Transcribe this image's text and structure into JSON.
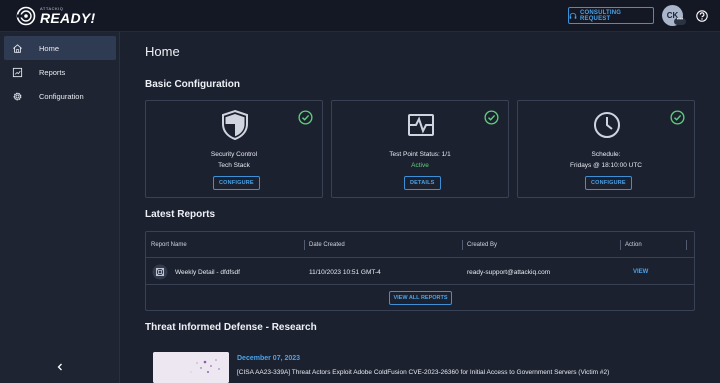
{
  "header": {
    "logo_small": "ATTACKIQ",
    "logo_big": "READY!",
    "consulting_label": "CONSULTING REQUEST",
    "avatar_initials": "CK",
    "avatar_more": "•••"
  },
  "sidebar": {
    "items": [
      {
        "label": "Home",
        "icon": "home-icon",
        "active": true
      },
      {
        "label": "Reports",
        "icon": "reports-icon",
        "active": false
      },
      {
        "label": "Configuration",
        "icon": "gear-icon",
        "active": false
      }
    ],
    "collapse_icon": "chevron-left-icon"
  },
  "main": {
    "page_title": "Home",
    "basic_config": {
      "title": "Basic Configuration",
      "cards": [
        {
          "line1": "Security Control",
          "line2": "Tech Stack",
          "button": "CONFIGURE",
          "icon": "shield-icon"
        },
        {
          "line1": "Test Point Status: 1/1",
          "line2": "Active",
          "button": "DETAILS",
          "icon": "test-point-icon"
        },
        {
          "line1": "Schedule:",
          "line2": "Fridays @ 18:10:00 UTC",
          "button": "CONFIGURE",
          "icon": "clock-icon"
        }
      ]
    },
    "latest_reports": {
      "title": "Latest Reports",
      "columns": [
        "Report Name",
        "Date Created",
        "Created By",
        "Action"
      ],
      "rows": [
        {
          "name": "Weekly Detail - dfdfsdf",
          "date": "11/10/2023 10:51 GMT-4",
          "created_by": "ready-support@attackiq.com",
          "action": "VIEW"
        }
      ],
      "view_all": "VIEW ALL REPORTS"
    },
    "research": {
      "title": "Threat Informed Defense - Research",
      "date": "December 07, 2023",
      "headline": "[CISA AA23-339A] Threat Actors Exploit Adobe ColdFusion CVE-2023-26360 for Initial Access to Government Servers (Victim #2)"
    }
  },
  "colors": {
    "accent": "#4aa3ea",
    "success": "#5fd07c",
    "background": "#1c2130",
    "sidebar": "#1f2433",
    "topbar": "#141824"
  }
}
